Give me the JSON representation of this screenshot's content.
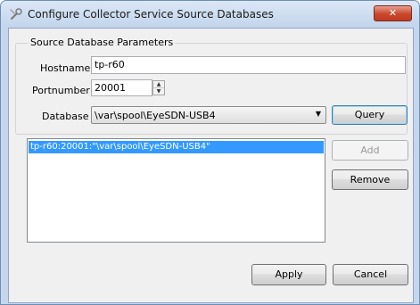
{
  "window": {
    "title": "Configure Collector Service Source Databases",
    "close_glyph": "✕",
    "icon": "configure-tools-icon"
  },
  "group": {
    "title": "Source Database Parameters"
  },
  "hostname": {
    "label": "Hostname",
    "value": "tp-r60"
  },
  "portnumber": {
    "label": "Portnumber",
    "value": "20001"
  },
  "database": {
    "label": "Database",
    "value": "\\var\\spool\\EyeSDN-USB4"
  },
  "buttons": {
    "query": "Query",
    "add": "Add",
    "remove": "Remove",
    "apply": "Apply",
    "cancel": "Cancel"
  },
  "sources_list": {
    "items": [
      "tp-r60:20001:\"\\var\\spool\\EyeSDN-USB4\""
    ]
  },
  "colors": {
    "selection": "#3399ff",
    "close_button": "#c9472c",
    "frame": "#c5d6ec"
  }
}
